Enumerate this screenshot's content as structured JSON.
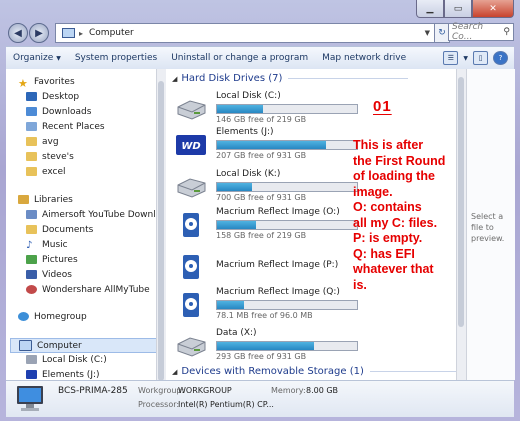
{
  "address": {
    "location": "Computer",
    "search_placeholder": "Search Co..."
  },
  "toolbar": {
    "organize": "Organize",
    "system_properties": "System properties",
    "uninstall": "Uninstall or change a program",
    "map_network": "Map network drive"
  },
  "nav": {
    "favorites": "Favorites",
    "desktop": "Desktop",
    "downloads": "Downloads",
    "recent": "Recent Places",
    "avg": "avg",
    "steves": "steve's",
    "excel": "excel",
    "libraries": "Libraries",
    "aimersoft": "Aimersoft YouTube Download",
    "documents": "Documents",
    "music": "Music",
    "pictures": "Pictures",
    "videos": "Videos",
    "wondershare": "Wondershare AllMyTube",
    "homegroup": "Homegroup",
    "computer": "Computer",
    "local_c": "Local Disk (C:)",
    "elements_j": "Elements (J:)"
  },
  "groups": {
    "hdd": "Hard Disk Drives (7)",
    "removable": "Devices with Removable Storage (1)"
  },
  "drives": [
    {
      "name": "Local Disk (C:)",
      "free": "146 GB free of 219 GB",
      "used_fraction": 0.33
    },
    {
      "name": "Elements (J:)",
      "free": "207 GB free of 931 GB",
      "used_fraction": 0.78
    },
    {
      "name": "Local Disk (K:)",
      "free": "700 GB free of 931 GB",
      "used_fraction": 0.25
    },
    {
      "name": "Macrium Reflect Image (O:)",
      "free": "158 GB free of 219 GB",
      "used_fraction": 0.28
    },
    {
      "name": "Macrium Reflect Image (P:)",
      "free": "",
      "used_fraction": null
    },
    {
      "name": "Macrium Reflect Image (Q:)",
      "free": "78.1 MB free of 96.0 MB",
      "used_fraction": 0.19
    },
    {
      "name": "Data (X:)",
      "free": "293 GB free of 931 GB",
      "used_fraction": 0.69
    }
  ],
  "annotation": {
    "number": "01",
    "lines": [
      "This is after",
      "the First Round",
      "of loading the",
      "image.",
      "O: contains",
      "all my C: files.",
      "P: is empty.",
      "Q: has EFI",
      "whatever that",
      "is."
    ]
  },
  "preview": {
    "text": "Select a file to preview."
  },
  "details": {
    "computer_name": "BCS-PRIMA-285",
    "workgroup_label": "Workgroup:",
    "workgroup_value": "WORKGROUP",
    "memory_label": "Memory:",
    "memory_value": "8.00 GB",
    "processor_label": "Processor:",
    "processor_value": "Intel(R) Pentium(R) CP..."
  },
  "colors": {
    "annotation": "#e60000",
    "bar_fill": "#2887c2",
    "group_heading": "#1e3b8c"
  }
}
